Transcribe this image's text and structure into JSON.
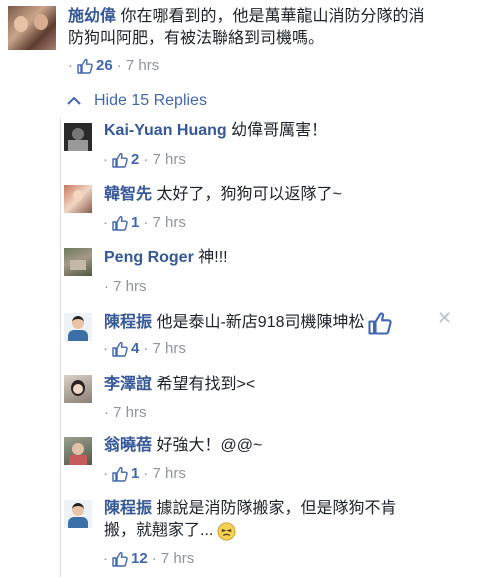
{
  "top_comment": {
    "author": "施幼偉",
    "text_line1": "你在哪看到的，他是萬華龍山消防分隊的消",
    "text_line2": "防狗叫阿肥，有被法聯絡到司機嗎。",
    "dot": "·",
    "likes": "26",
    "time": "· 7 hrs"
  },
  "hide_replies_label": "Hide 15 Replies",
  "replies": [
    {
      "author": "Kai-Yuan Huang",
      "text": "幼偉哥厲害！",
      "dot": "·",
      "likes": "2",
      "time": "· 7 hrs"
    },
    {
      "author": "韓智先",
      "text": "太好了，狗狗可以返隊了~",
      "dot": "·",
      "likes": "1",
      "time": "· 7 hrs"
    },
    {
      "author": "Peng Roger",
      "text": "神!!!",
      "time": "· 7 hrs"
    },
    {
      "author": "陳程振",
      "text": "他是泰山-新店918司機陳坤松",
      "dot": "·",
      "likes": "4",
      "time": "· 7 hrs",
      "close": "✕"
    },
    {
      "author": "李澤誼",
      "text": "希望有找到><",
      "time": "· 7 hrs"
    },
    {
      "author": "翁曉蓓",
      "text": "好強大！@@~",
      "dot": "·",
      "likes": "1",
      "time": "· 7 hrs"
    },
    {
      "author": "陳程振",
      "text_line1": "據說是消防隊搬家，但是隊狗不肯",
      "text_line2": "搬，就翹家了...",
      "dot": "·",
      "likes": "12",
      "time": "· 7 hrs"
    }
  ],
  "colors": {
    "link": "#365899",
    "like": "#4267b2",
    "meta": "#90949c",
    "text": "#1d2129"
  }
}
